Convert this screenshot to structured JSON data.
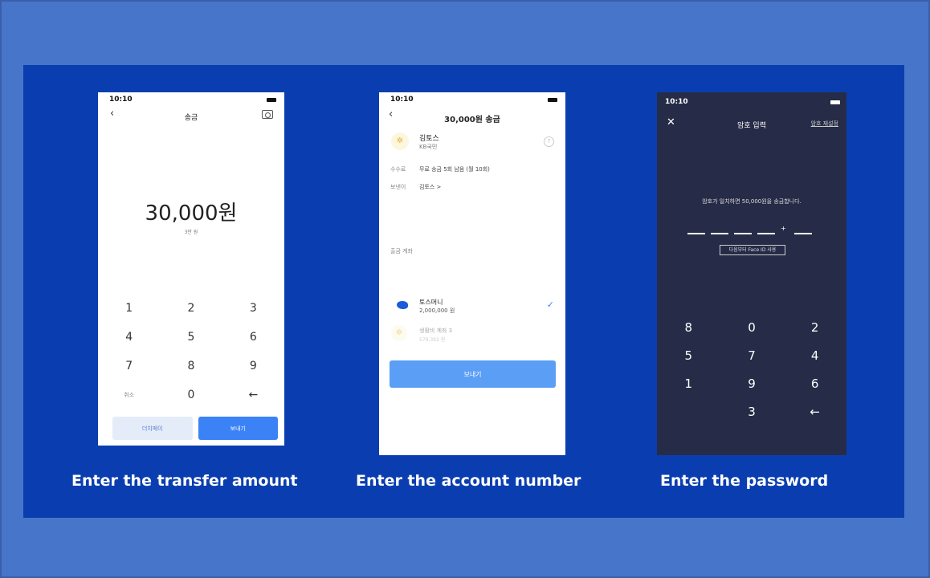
{
  "screen1": {
    "time": "10:10",
    "title": "송금",
    "amount": "30,000원",
    "amount_sub": "3만 원",
    "keys": [
      "1",
      "2",
      "3",
      "4",
      "5",
      "6",
      "7",
      "8",
      "9",
      "취소",
      "0",
      "←"
    ],
    "secondary_button": "더치페이",
    "primary_button": "보내기",
    "caption": "Enter the transfer amount"
  },
  "screen2": {
    "time": "10:10",
    "title": "30,000원 송금",
    "recipient_name": "김토스",
    "recipient_bank": "KB국민",
    "fee_label": "수수료",
    "fee_value": "무료 송금 5회 남음 (월 10회)",
    "sender_label": "보낸이",
    "sender_value": "김토스 >",
    "account_section_label": "출금 계좌",
    "account1_name": "토스머니",
    "account1_balance": "2,000,000 원",
    "account2_name": "생활비 계좌 3",
    "account2_balance": "579,392 원",
    "send_button": "보내기",
    "caption": "Enter the account number"
  },
  "screen3": {
    "time": "10:10",
    "title": "암호 입력",
    "reset_link": "암호 재설정",
    "message": "암호가 일치하면 50,000원을 송금합니다.",
    "faceid_option": "다음부터 Face ID 사용",
    "keys": [
      "8",
      "0",
      "2",
      "5",
      "7",
      "4",
      "1",
      "9",
      "6",
      "",
      "3",
      "←"
    ],
    "caption": "Enter the password"
  },
  "colors": {
    "background": "#4775c9",
    "panel": "#0a3eb0",
    "accent": "#3b82f6",
    "dark_screen": "#262c47"
  }
}
